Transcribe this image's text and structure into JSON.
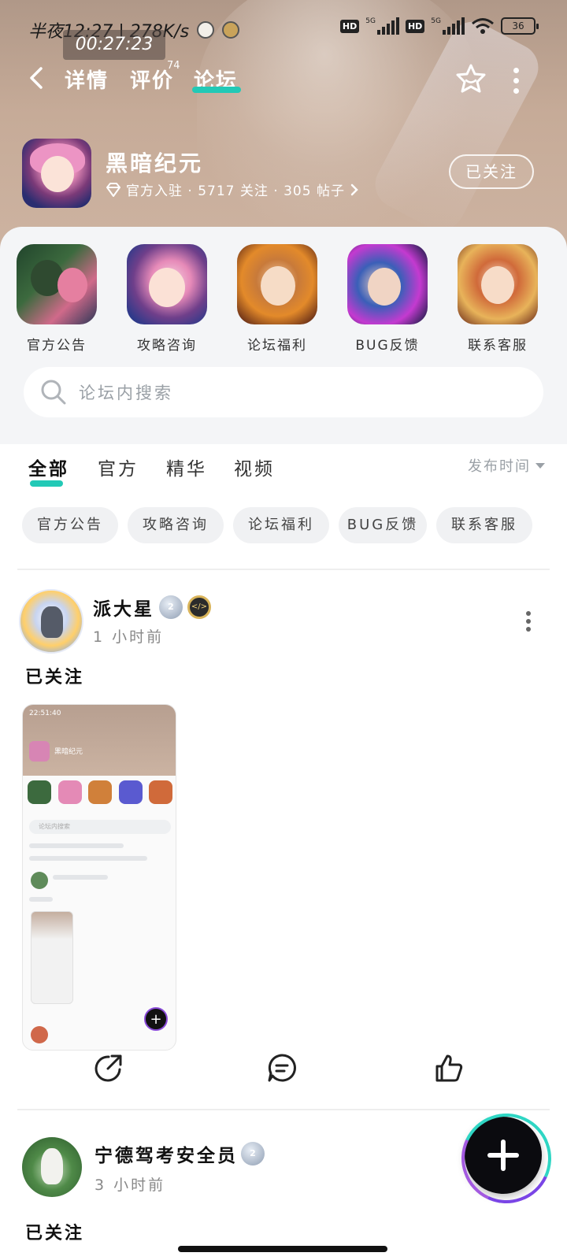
{
  "status_bar": {
    "left_text": "半夜12:27 | 278K/s",
    "timer": "00:27:23",
    "hd1": "HD",
    "hd2": "HD",
    "net1": "5G",
    "net2": "5G",
    "battery": "36"
  },
  "nav": {
    "tabs": [
      "详情",
      "评价",
      "论坛"
    ],
    "active_tab": "论坛",
    "rating_badge": "74"
  },
  "game": {
    "title": "黑暗纪元",
    "subtitle": "官方入驻 · 5717 关注 · 305 帖子",
    "follow_label": "已关注"
  },
  "categories": [
    "官方公告",
    "攻略咨询",
    "论坛福利",
    "BUG反馈",
    "联系客服"
  ],
  "search": {
    "placeholder": "论坛内搜索"
  },
  "filter_tabs": [
    "全部",
    "官方",
    "精华",
    "视频"
  ],
  "sort_label": "发布时间",
  "chips": [
    "官方公告",
    "攻略咨询",
    "论坛福利",
    "BUG反馈",
    "联系客服"
  ],
  "posts": [
    {
      "author": "派大星",
      "level": "2",
      "time": "1 小时前",
      "text": "已关注",
      "screenshot": {
        "time": "22:51:40",
        "title": "黑暗纪元",
        "search": "论坛内搜索"
      }
    },
    {
      "author": "宁德驾考安全员",
      "level": "2",
      "time": "3 小时前",
      "text": "已关注"
    }
  ],
  "colors": {
    "accent": "#22c9b6",
    "fab_ring_teal": "#2fd6c4",
    "fab_ring_purple": "#7a45e6"
  },
  "icons": [
    "back-arrow-icon",
    "star-icon",
    "more-vertical-icon",
    "diamond-icon",
    "chevron-right-icon",
    "search-icon",
    "share-icon",
    "comment-icon",
    "like-icon",
    "plus-icon"
  ]
}
